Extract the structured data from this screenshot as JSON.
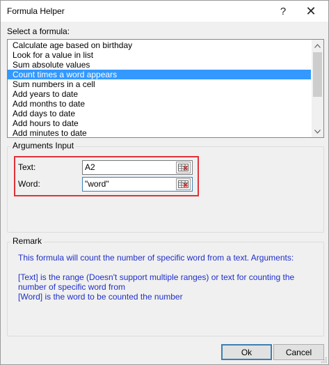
{
  "window": {
    "title": "Formula Helper",
    "help_glyph": "?",
    "close_glyph": "✕"
  },
  "formula_list": {
    "label": "Select a formula:",
    "items": [
      "Calculate age based on birthday",
      "Look for a value in list",
      "Sum absolute values",
      "Count times a word appears",
      "Sum numbers in a cell",
      "Add years to date",
      "Add months to date",
      "Add days to date",
      "Add hours to date",
      "Add minutes to date"
    ],
    "selected_index": 3
  },
  "arguments": {
    "legend": "Arguments Input",
    "text_label": "Text:",
    "text_value": "A2",
    "word_label": "Word:",
    "word_value": "\"word\""
  },
  "remark": {
    "legend": "Remark",
    "line1": "This formula will count the number of specific word from a text. Arguments:",
    "line2": "[Text] is the range (Doesn't support multiple ranges) or text for counting the number of specific word from",
    "line3": "[Word] is the word to be counted the number"
  },
  "buttons": {
    "ok": "Ok",
    "cancel": "Cancel"
  },
  "colors": {
    "selection": "#3399ff",
    "remark_text": "#1f2fc9",
    "highlight_border": "#e0323a"
  }
}
